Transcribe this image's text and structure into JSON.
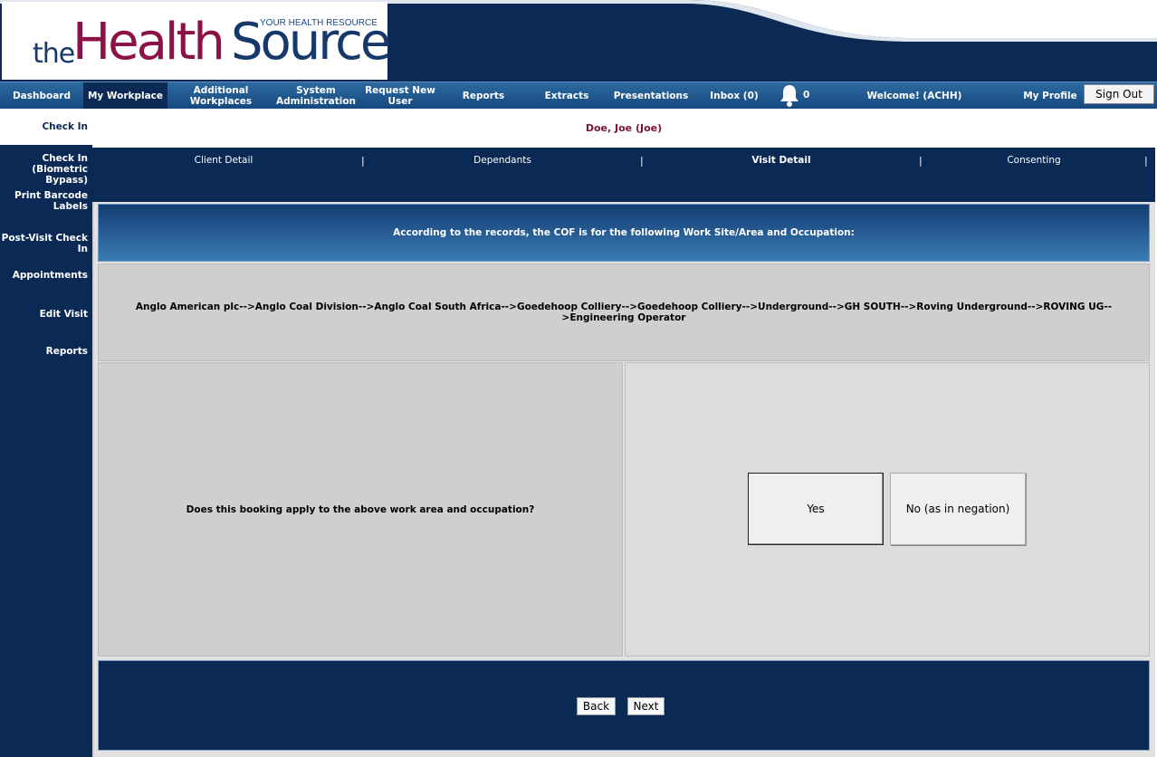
{
  "logo": {
    "the": "the",
    "health": "Health",
    "source": "Source",
    "tagline": "YOUR HEALTH RESOURCE"
  },
  "topnav": {
    "items": [
      "Dashboard",
      "My Workplace",
      "Additional Workplaces",
      "System Administration",
      "Request New User",
      "Reports",
      "Extracts",
      "Presentations",
      "Inbox (0)"
    ],
    "notifications_count": "0",
    "welcome": "Welcome! (ACHH)",
    "my_profile": "My Profile",
    "sign_out": "Sign Out"
  },
  "sidebar": {
    "items": [
      "Check In",
      "Check In (Biometric Bypass)",
      "Print Barcode Labels",
      "Post-Visit Check In",
      "Appointments",
      "Edit Visit",
      "Reports"
    ]
  },
  "patient": {
    "name": "Doe, Joe (Joe)"
  },
  "subtabs": {
    "items": [
      "Client Detail",
      "Dependants",
      "Visit Detail",
      "Consenting"
    ],
    "active": "Visit Detail"
  },
  "cof": {
    "banner": "According to the records, the COF is for the following Work Site/Area and Occupation:",
    "path": "Anglo American plc-->Anglo Coal Division-->Anglo Coal South Africa-->Goedehoop Colliery-->Goedehoop Colliery-->Underground-->GH SOUTH-->Roving Underground-->ROVING UG-->Engineering Operator",
    "question": "Does this booking apply to the above work area and occupation?",
    "yes": "Yes",
    "no": "No (as in negation)"
  },
  "footer": {
    "back": "Back",
    "next": "Next"
  },
  "colors": {
    "navy": "#0a2a55",
    "brand_maroon": "#8c1146",
    "brand_blue": "#16386a",
    "patient_name": "#7a1232"
  }
}
